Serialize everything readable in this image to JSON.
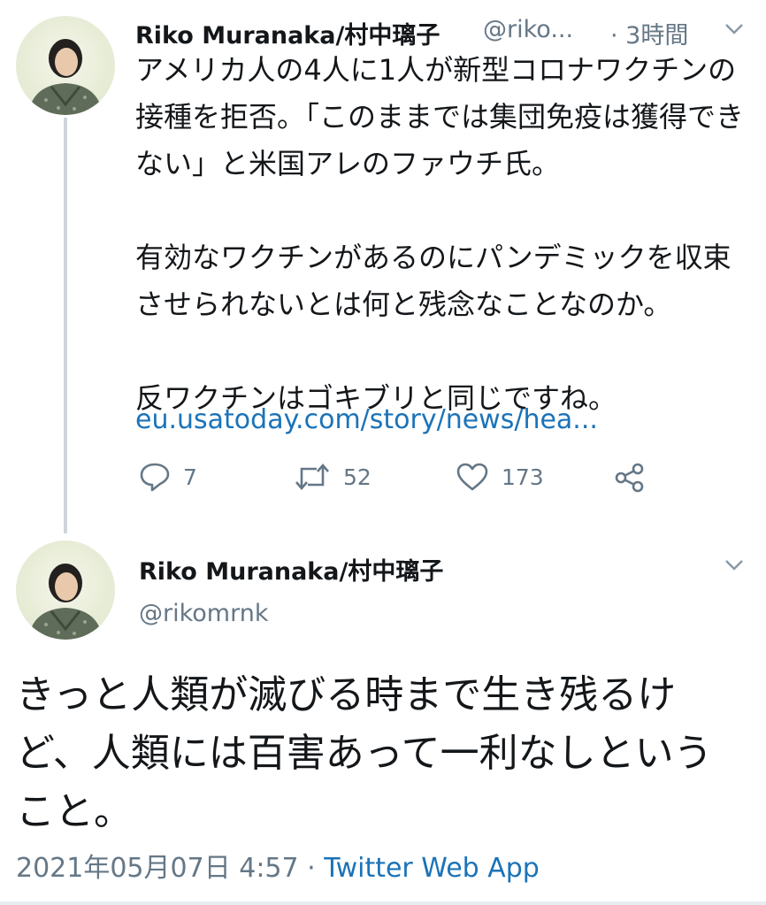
{
  "tweet1": {
    "display_name": "Riko Muranaka/村中璃子",
    "handle": "@riko...",
    "time": "· 3時間",
    "text": "アメリカ人の4人に1人が新型コロナワクチンの接種を拒否。「このままでは集団免疫は獲得できない」と米国アレのファウチ氏。\n\n有効なワクチンがあるのにパンデミックを収束させられないとは何と残念なことなのか。\n\n反ワクチンはゴキブリと同じですね。",
    "link": "eu.usatoday.com/story/news/hea...",
    "reply_count": "7",
    "retweet_count": "52",
    "like_count": "173"
  },
  "tweet2": {
    "display_name": "Riko Muranaka/村中璃子",
    "handle": "@rikomrnk",
    "text": "きっと人類が滅びる時まで生き残るけど、人類には百害あって一利なしということ。",
    "datetime": "2021年05月07日 4:57 · ",
    "source": "Twitter Web App"
  },
  "icons": {
    "reply": "reply-icon",
    "retweet": "retweet-icon",
    "like": "heart-icon",
    "share": "share-icon",
    "menu": "chevron-down-icon"
  },
  "colors": {
    "link": "#1b73b8",
    "secondary_text": "#657786",
    "thread_line": "#d0d5da"
  }
}
